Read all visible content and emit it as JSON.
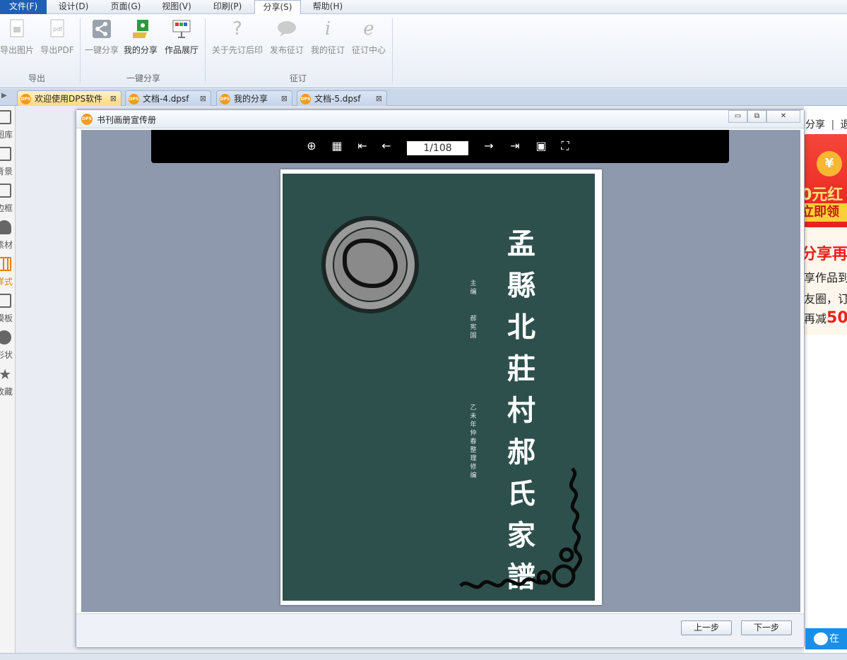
{
  "menubar": {
    "items": [
      "文件(F)",
      "设计(D)",
      "页面(G)",
      "视图(V)",
      "印刷(P)",
      "分享(S)",
      "帮助(H)"
    ],
    "active": "分享(S)"
  },
  "ribbon": {
    "buttons": {
      "export_image": "导出图片",
      "export_pdf": "导出PDF",
      "one_click_share": "一键分享",
      "my_share": "我的分享",
      "gallery": "作品展厅",
      "about_preorder": "关于先订后印",
      "publish_order": "发布征订",
      "my_orders": "我的征订",
      "order_center": "征订中心"
    },
    "groups": {
      "export": "导出",
      "share": "一键分享",
      "order": "征订"
    },
    "pdf_glyph": "pdf"
  },
  "tabs": [
    {
      "label": "欢迎使用DPS软件",
      "active": true
    },
    {
      "label": "文档-4.dpsf",
      "active": false
    },
    {
      "label": "我的分享",
      "active": false
    },
    {
      "label": "文档-5.dpsf",
      "active": false
    }
  ],
  "tab_logo": "DPS",
  "tab_close": "⊠",
  "sidebar": {
    "collapse_arrow": "▶",
    "items": [
      "图库",
      "背景",
      "边框",
      "素材",
      "样式",
      "模板",
      "形状",
      "收藏"
    ]
  },
  "right_panel": {
    "share_link": "分享",
    "divider": "|",
    "exit_link": "退",
    "ad_headline": "0元红",
    "ad_button": "立即领",
    "promo_title": "分享再",
    "promo_line1": "享作品到",
    "promo_line2": "友圈，订",
    "promo_line3_prefix": "再减",
    "promo_line3_amount": "50",
    "coin_symbol": "¥",
    "chat_label": "在"
  },
  "dialog": {
    "title": "书刊画册宣传册",
    "logo": "DPS",
    "buttons": {
      "minimize": "▭",
      "restore": "⧉",
      "close": "✕"
    },
    "viewer": {
      "tools": {
        "zoom": "⊕",
        "grid": "▦",
        "first": "⇤",
        "prev": "←",
        "next": "→",
        "last": "⇥",
        "single": "▣",
        "fullscreen": "⛶"
      },
      "page_indicator": "1/108"
    },
    "cover": {
      "title": "孟縣北莊村郝氏家譜",
      "editor_role": "主编",
      "editor_name": "郝宪国",
      "date_note": "乙未年仲春整理修编"
    },
    "footer": {
      "prev": "上一步",
      "next": "下一步"
    }
  },
  "colors": {
    "cover_green": "#2d504c",
    "viewer_bg": "#8e99ad",
    "menu_file": "#1f5fb5",
    "active_tab": "#ffd97c",
    "promo_red": "#e8221b"
  }
}
